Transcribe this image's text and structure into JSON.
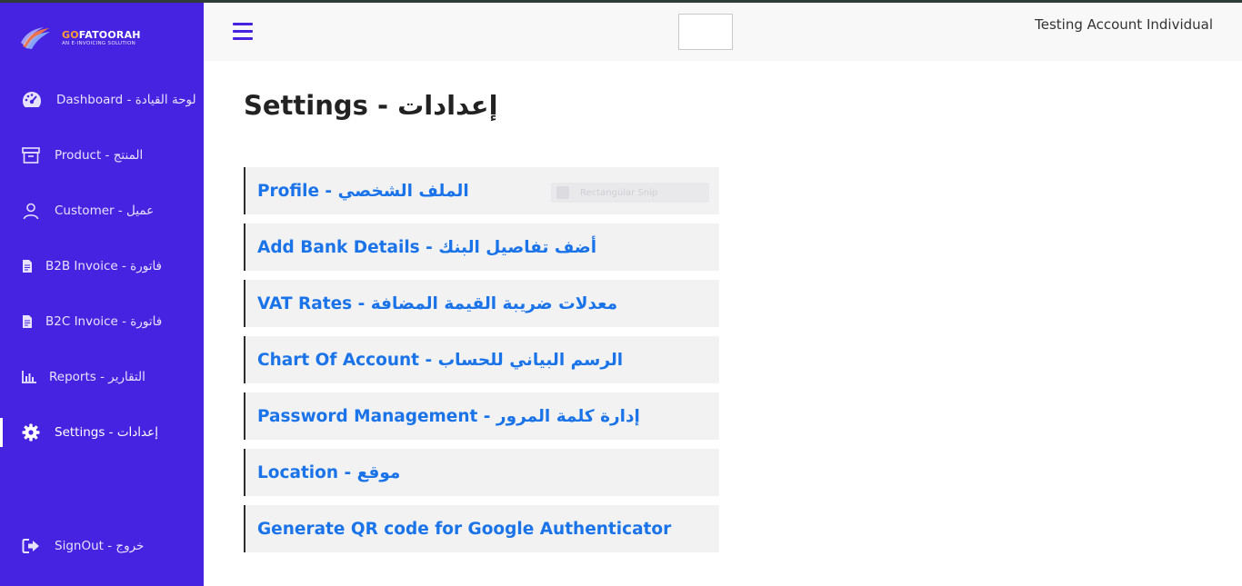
{
  "brand": {
    "name_prefix": "GO",
    "name_rest": "FATOORAH",
    "tagline": "AN E-INVOICING SOLUTION"
  },
  "sidebar": {
    "items": [
      {
        "label": "Dashboard - لوحة القيادة",
        "icon": "dashboard-gauge-icon"
      },
      {
        "label": "Product - المنتج",
        "icon": "archive-box-icon"
      },
      {
        "label": "Customer - عميل",
        "icon": "user-icon"
      },
      {
        "label": "B2B Invoice - فاتورة",
        "icon": "document-icon"
      },
      {
        "label": "B2C Invoice - فاتورة",
        "icon": "document-icon"
      },
      {
        "label": "Reports - التقارير",
        "icon": "bar-chart-icon"
      },
      {
        "label": "Settings - إعدادات",
        "icon": "gear-icon",
        "active": true
      }
    ],
    "signout": {
      "label": "SignOut - خروج",
      "icon": "sign-out-icon"
    }
  },
  "header": {
    "account_name": "Testing Account Individual"
  },
  "main": {
    "title": "Settings - إعدادات",
    "settings_items": [
      "Profile - الملف الشخصي",
      "Add Bank Details - أضف تفاصيل البنك",
      "VAT Rates - معدلات ضريبة القيمة المضافة",
      "Chart Of Account - الرسم البياني للحساب",
      "Password Management - إدارة كلمة المرور",
      "Location - موقع",
      "Generate QR code for Google Authenticator"
    ],
    "overlay_ghost_text": "Rectangular Snip"
  },
  "colors": {
    "sidebar_bg": "#4623e0",
    "link_blue": "#1a73e8",
    "item_bg": "#f2f2f2",
    "header_bg": "#f8f8f9"
  }
}
